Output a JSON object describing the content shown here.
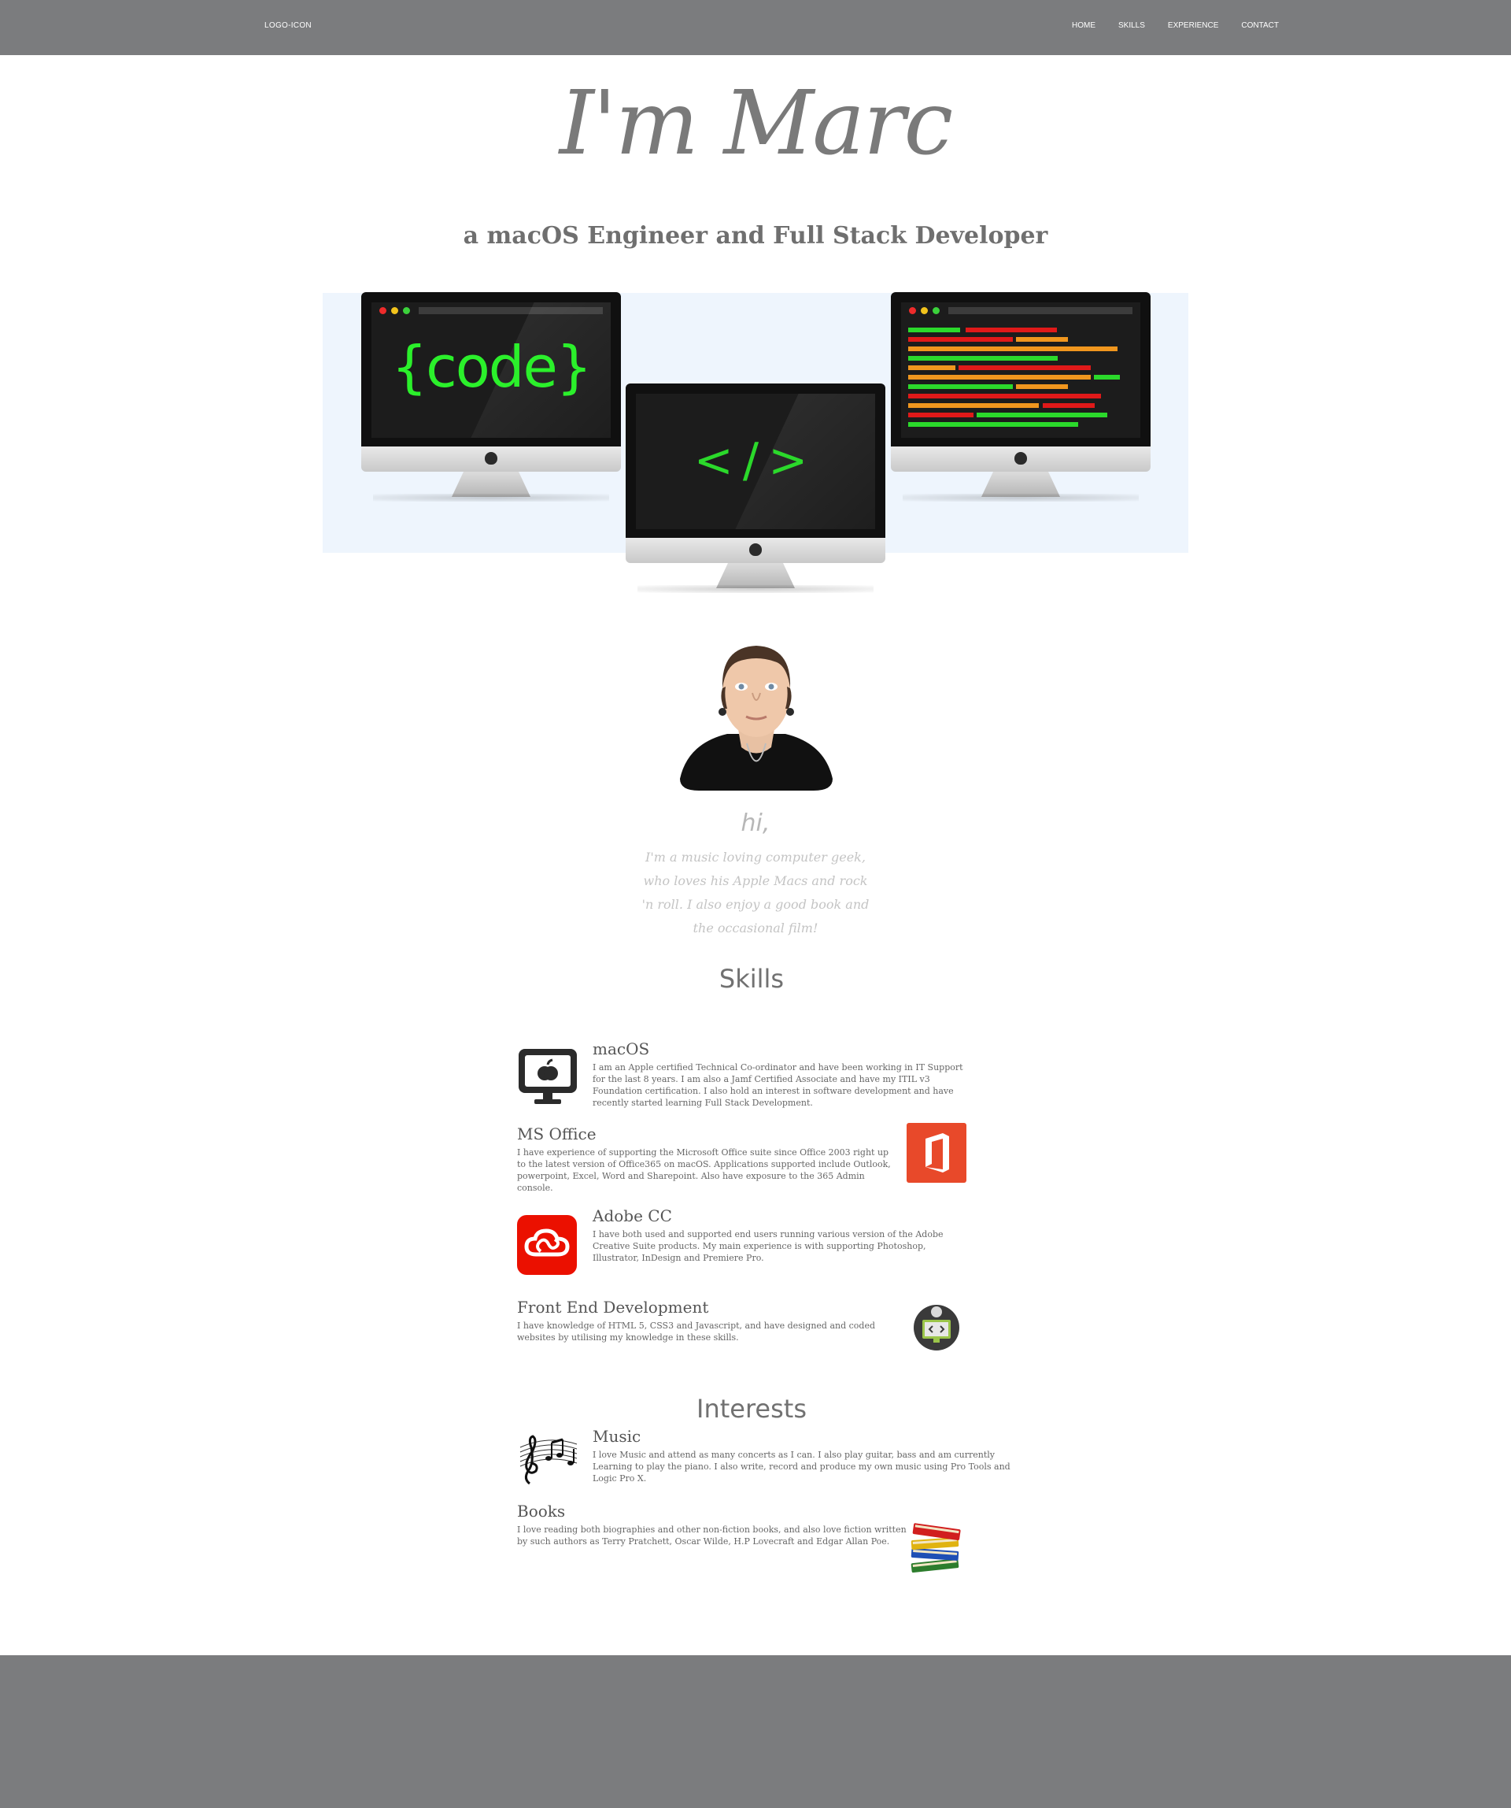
{
  "nav": {
    "logo": "LOGO-ICON",
    "links": [
      "HOME",
      "SKILLS",
      "EXPERIENCE",
      "CONTACT"
    ]
  },
  "hero": {
    "title": "I'm Marc",
    "subtitle": "a macOS Engineer and Full Stack Developer",
    "screens": {
      "left_text": "{code}",
      "center_text": "</>"
    }
  },
  "about": {
    "greeting": "hi,",
    "intro": "I'm a music loving computer geek, who loves his Apple Macs and rock 'n roll. I also enjoy a good book and the occasional film!"
  },
  "skills": {
    "title": "Skills",
    "items": [
      {
        "name": "macOS",
        "icon": "imac-apple-icon",
        "text": "I am an Apple certified Technical Co-ordinator and have been working in IT Support for the last 8 years. I am also a Jamf Certified Associate and have my  ITIL v3 Foundation certification. I also hold an interest in software development and have recently started learning Full Stack Development."
      },
      {
        "name": "MS Office",
        "icon": "office-icon",
        "text": "I have experience of supporting the Microsoft Office suite since Office 2003 right up to the latest version of Office365 on macOS. Applications supported include Outlook, powerpoint, Excel, Word and Sharepoint. Also have exposure to the 365 Admin console."
      },
      {
        "name": "Adobe CC",
        "icon": "adobe-cc-icon",
        "text": "I have both used and supported end users running various version of the Adobe Creative Suite products. My main experience is with supporting Photoshop, Illustrator, InDesign and Premiere Pro."
      },
      {
        "name": "Front End Development",
        "icon": "web-dev-icon",
        "text": "I have knowledge of HTML 5, CSS3 and Javascript, and have designed and coded websites by utilising my knowledge in these skills."
      }
    ]
  },
  "interests": {
    "title": "Interests",
    "items": [
      {
        "name": "Music",
        "icon": "music-notes-icon",
        "text": "I love Music and attend as many concerts as I can. I also play guitar, bass and am currently Learning to play the piano. I also write, record and produce my own music using Pro Tools and Logic Pro X."
      },
      {
        "name": "Books",
        "icon": "books-icon",
        "text": "I love reading both biographies and other non-fiction books, and also love fiction written by such authors as Terry Pratchett, Oscar Wilde, H.P Lovecraft and Edgar Allan Poe."
      }
    ]
  },
  "colors": {
    "nav_bg": "#7b7c7e",
    "banner_bg": "#eef5fd",
    "code_green": "#2bf02b",
    "code_red": "#e01919",
    "code_orange": "#f0961e",
    "office_red": "#e8492a",
    "adobe_red": "#eb1000"
  }
}
